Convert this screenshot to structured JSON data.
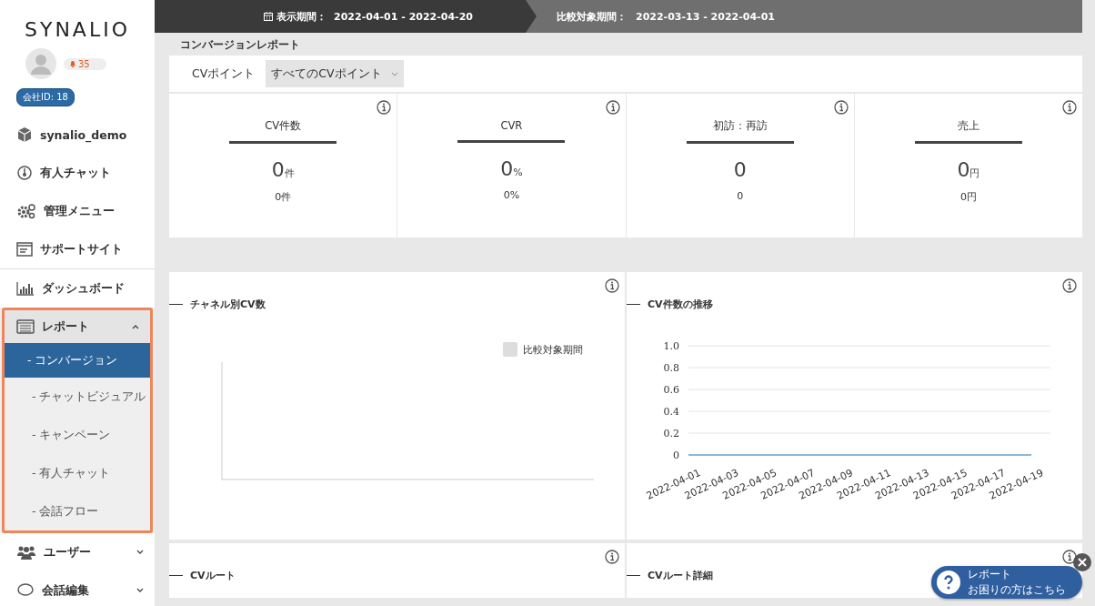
{
  "sidebar": {
    "logo": "SYNALIO",
    "notification_count": "35",
    "company_badge": "会社ID: 18",
    "items": [
      {
        "label": "synalio_demo"
      },
      {
        "label": "有人チャット"
      },
      {
        "label": "管理メニュー"
      },
      {
        "label": "サポートサイト"
      },
      {
        "label": "ダッシュボード"
      },
      {
        "label": "レポート",
        "expanded": true,
        "highlighted": true,
        "children": [
          {
            "label": "- コンバージョン",
            "selected": true
          },
          {
            "label": "- チャットビジュアル",
            "selected": false
          },
          {
            "label": "- キャンペーン",
            "selected": false
          },
          {
            "label": "- 有人チャット",
            "selected": false
          },
          {
            "label": "- 会話フロー",
            "selected": false
          }
        ]
      },
      {
        "label": "ユーザー",
        "expanded": false
      },
      {
        "label": "会話編集",
        "expanded": false
      }
    ]
  },
  "top_bar": {
    "display_period_label": "表示期間：",
    "display_period": "2022-04-01 - 2022-04-20",
    "compare_period_label": "比較対象期間：",
    "compare_period": "2022-03-13 - 2022-04-01"
  },
  "page_title": "コンバージョンレポート",
  "filter": {
    "label": "CVポイント",
    "value": "すべてのCVポイント"
  },
  "metrics": [
    {
      "title": "CV件数",
      "value": "0",
      "unit": "件",
      "sub": "0件"
    },
    {
      "title": "CVR",
      "value": "0",
      "unit": "%",
      "sub": "0%"
    },
    {
      "title": "初訪：再訪",
      "value": "0",
      "sub": "0"
    },
    {
      "title": "売上",
      "value": "0",
      "unit": "円",
      "sub": "0円"
    }
  ],
  "panels": [
    {
      "title": "チャネル別CV数",
      "kind": "legend_chart",
      "legend": "比較対象期間"
    },
    {
      "title": "CV件数の推移",
      "kind": "line_chart",
      "chart_data": {
        "type": "line",
        "categories": [
          "2022-04-01",
          "2022-04-03",
          "2022-04-05",
          "2022-04-07",
          "2022-04-09",
          "2022-04-11",
          "2022-04-13",
          "2022-04-15",
          "2022-04-17",
          "2022-04-19"
        ],
        "ylim": [
          0,
          1
        ],
        "grid": true,
        "yticks": [
          {
            "value": 0,
            "label": "0"
          },
          {
            "value": 0.2,
            "label": "0.2"
          },
          {
            "value": 0.4,
            "label": "0.4"
          },
          {
            "value": 0.6,
            "label": "0.6"
          },
          {
            "value": 0.8,
            "label": "0.8"
          },
          {
            "value": 1,
            "label": "1.0"
          }
        ],
        "series": [
          {
            "color": "#8fb8d8",
            "values": [
              0,
              0,
              0,
              0,
              0,
              0,
              0,
              0,
              0,
              0
            ]
          }
        ]
      }
    },
    {
      "title": "CVルート",
      "kind": "empty"
    },
    {
      "title": "CVルート詳細",
      "kind": "empty"
    }
  ],
  "help": {
    "title": "レポート",
    "subtitle": "お困りの方はこちら"
  }
}
